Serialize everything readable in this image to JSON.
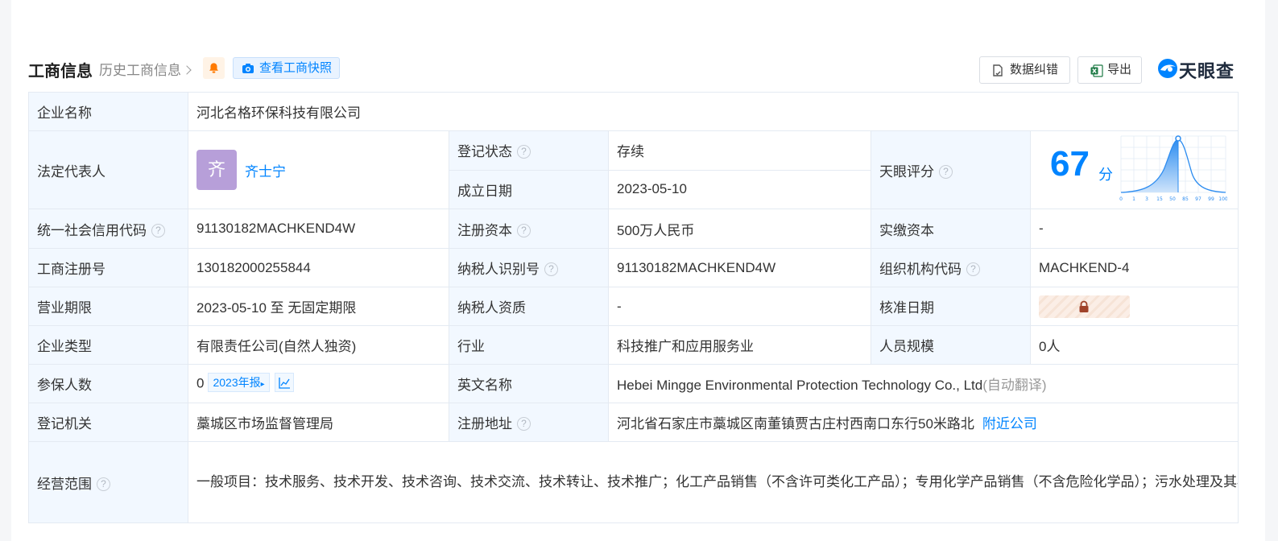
{
  "header": {
    "title": "工商信息",
    "history_link": "历史工商信息",
    "snapshot_button": "查看工商快照",
    "data_error_button": "数据纠错",
    "export_button": "导出",
    "logo_text": "天眼查"
  },
  "company_name": {
    "label": "企业名称",
    "value": "河北名格环保科技有限公司"
  },
  "legal_rep": {
    "label": "法定代表人",
    "avatar_char": "齐",
    "name": "齐士宁"
  },
  "reg_status": {
    "label": "登记状态",
    "value": "存续"
  },
  "est_date": {
    "label": "成立日期",
    "value": "2023-05-10"
  },
  "tianyan_score": {
    "label": "天眼评分",
    "value": "67",
    "unit": "分",
    "axis_ticks": [
      "0",
      "1",
      "3",
      "15",
      "50",
      "85",
      "97",
      "99",
      "100"
    ]
  },
  "credit_code": {
    "label": "统一社会信用代码",
    "value": "91130182MACHKEND4W"
  },
  "reg_capital": {
    "label": "注册资本",
    "value": "500万人民币"
  },
  "paid_capital": {
    "label": "实缴资本",
    "value": "-"
  },
  "biz_reg_no": {
    "label": "工商注册号",
    "value": "130182000255844"
  },
  "taxpayer_id": {
    "label": "纳税人识别号",
    "value": "91130182MACHKEND4W"
  },
  "org_code": {
    "label": "组织机构代码",
    "value": "MACHKEND-4"
  },
  "biz_term": {
    "label": "营业期限",
    "value": "2023-05-10 至 无固定期限"
  },
  "taxpayer_qual": {
    "label": "纳税人资质",
    "value": "-"
  },
  "approval_date": {
    "label": "核准日期"
  },
  "company_type": {
    "label": "企业类型",
    "value": "有限责任公司(自然人独资)"
  },
  "industry": {
    "label": "行业",
    "value": "科技推广和应用服务业"
  },
  "staff_size": {
    "label": "人员规模",
    "value": "0人"
  },
  "insured": {
    "label": "参保人数",
    "value": "0",
    "report_tag": "2023年报"
  },
  "english_name": {
    "label": "英文名称",
    "value": "Hebei Mingge Environmental Protection Technology Co., Ltd",
    "note": "(自动翻译)"
  },
  "reg_authority": {
    "label": "登记机关",
    "value": "藁城区市场监督管理局"
  },
  "reg_address": {
    "label": "注册地址",
    "value": "河北省石家庄市藁城区南董镇贾古庄村西南口东行50米路北",
    "nearby_link": "附近公司"
  },
  "biz_scope": {
    "label": "经营范围",
    "value": "一般项目：技术服务、技术开发、技术咨询、技术交流、技术转让、技术推广；化工产品销售（不含许可类化工产品）；专用化学产品销售（不含危险化学品）；污水处理及其再生利用；水污染治理；水环境污染防治服务；环境保护专用设备销售；专用化学产品制造（不含危险化学品，不含前置审批及政府禁止、限制事项）。（除依法须经批准的项目外，凭营业执照依法自主开展经营活动）"
  },
  "colors": {
    "accent": "#0084ff",
    "label_bg": "#f2f8ff",
    "status_green": "#00a35a"
  }
}
